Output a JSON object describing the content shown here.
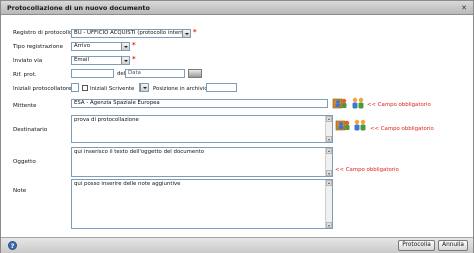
{
  "window": {
    "title": "Protocollazione di un nuovo documento"
  },
  "labels": {
    "registro": "Registro di protocollo",
    "tipo": "Tipo registrazione",
    "inviato": "Inviato via",
    "rif_prot": "Rif. prot.",
    "del": "del",
    "iniziali": "Iniziali protocollatore",
    "iniziali_scrivente": "Iniziali Scrivente",
    "posizione": "Posizione in archivio",
    "mittente": "Mittente",
    "destinatario": "Destinatario",
    "oggetto": "Oggetto",
    "note": "Note"
  },
  "fields": {
    "registro_value": "BU - UFFICIO ACQUISTI (protocollo interno)",
    "tipo_value": "Arrivo",
    "inviato_value": "Email",
    "rif_prot_value": "",
    "data_placeholder": "Data",
    "iniziali_value": "",
    "posizione_value": "",
    "mittente_value": "ESA - Agenzia Spaziale Europea",
    "destinatario_value": "prova di protocollazione",
    "oggetto_value": "qui inserisco il testo dell'oggetto del documento",
    "note_value": "qui posso inserire delle note aggiuntive"
  },
  "required_mark": "*",
  "warnings": {
    "mittente": "<< Campo obbligatorio",
    "destinatario": "<< Campo obbligatorio",
    "oggetto": "<< Campo obbligatorio"
  },
  "footer": {
    "help": "?",
    "protocolla": "Protocolla",
    "annulla": "Annulla"
  },
  "icons": {
    "close": "close-icon",
    "help": "help-icon",
    "address_book": "address-book-icon",
    "users": "users-group-icon",
    "calendar": "calendar-icon"
  }
}
